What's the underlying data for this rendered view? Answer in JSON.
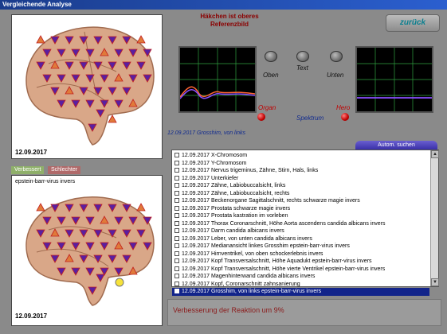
{
  "window": {
    "title": "Vergleichende Analyse"
  },
  "left": {
    "top_date": "12.09.2017",
    "bottom_date": "12.09.2017",
    "tab_improved": "Verbessert",
    "tab_worsened": "Schlechter",
    "bottom_label": "epstein-barr-virus invers"
  },
  "hint": {
    "line1": "Häkchen ist oberes",
    "line2": "Referenzbild"
  },
  "back_button": "zurück",
  "controls": {
    "oben": "Oben",
    "text": "Text",
    "unten": "Unten",
    "organ": "Organ",
    "spektrum": "Spektrum",
    "hero": "Hero"
  },
  "caption": "12.09.2017 Grosshim, von links",
  "auto_search": "Autom. suchen",
  "list": [
    "12.09.2017 X-Chromosom",
    "12.09.2017 Y-Chromosom",
    "12.09.2017 Nervus trigeminus, Zähne, Stirn, Hals, links",
    "12.09.2017 Unterkiefer",
    "12.09.2017 Zähne, Labiobuccalsicht, links",
    "12.09.2017 Zähne, Labiobuccalsicht, rechts",
    "12.09.2017 Beckenorgane Sagittalschnitt, rechts  schwarze magie invers",
    "12.09.2017 Prostata  schwarze magie invers",
    "12.09.2017 Prostata  kastration im vorleben",
    "12.09.2017 Thorax Coronarschnitt, Höhe Aorta ascendens  candida albicans invers",
    "12.09.2017 Darm  candida albicans invers",
    "12.09.2017 Leber, von unten  candida albicans invers",
    "12.09.2017 Medianansicht linkes Grosshim  epstein-barr-virus invers",
    "12.09.2017 Hirnventrikel, von oben  schockerlebnis invers",
    "12.09.2017 Kopf Transversalschnitt, Höhe Aquadukt  epstein-barr-virus invers",
    "12.09.2017 Kopf Transversalschnitt, Höhe vierte Ventrikel  epstein-barr-virus invers",
    "12.09.2017 Magenhinterwand  candida albicans invers",
    "12.09.2017 Kopf, Coronarschnitt  zahnsanierung",
    "12.09.2017 Grosshim, von links  epstein-barr-virus invers"
  ],
  "selected_index": 18,
  "status_text": "Verbesserung der Reaktion um 9%",
  "colors": {
    "accent": "#12248a",
    "hint": "#8b0000",
    "scope_line": "#2f9f3f"
  }
}
